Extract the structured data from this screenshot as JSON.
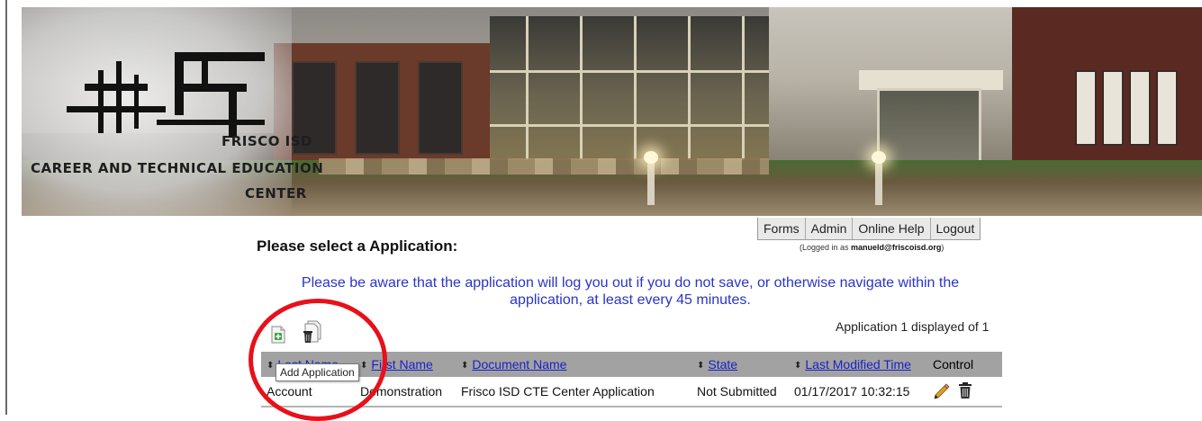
{
  "banner": {
    "logo_line1": "FRISCO ISD",
    "logo_line2": "CAREER AND TECHNICAL EDUCATION",
    "logo_line3": "CENTER"
  },
  "nav": {
    "items": [
      {
        "label": "Forms"
      },
      {
        "label": "Admin"
      },
      {
        "label": "Online Help"
      },
      {
        "label": "Logout"
      }
    ]
  },
  "page": {
    "heading": "Please select a Application:",
    "logged_in_prefix": "(Logged in as ",
    "logged_in_user": "manueld@friscoisd.org",
    "logged_in_suffix": ")",
    "notice_line1": "Please be aware that the application will log you out if you do not save, or otherwise navigate within the",
    "notice_line2": "application, at least every 45 minutes.",
    "count_text": "Application 1 displayed of 1"
  },
  "toolbar": {
    "add_icon": "add-document-icon",
    "delete_icon": "delete-multiple-icon",
    "tooltip": "Add Application"
  },
  "table": {
    "columns": [
      {
        "label": "Last Name",
        "sortable": true
      },
      {
        "label": "First Name",
        "sortable": true
      },
      {
        "label": "Document Name",
        "sortable": true
      },
      {
        "label": "State",
        "sortable": true
      },
      {
        "label": "Last Modified Time",
        "sortable": true
      },
      {
        "label": "Control",
        "sortable": false
      }
    ],
    "rows": [
      {
        "last_name": "Account",
        "first_name": "Demonstration",
        "document_name": "Frisco ISD CTE Center Application",
        "state": "Not Submitted",
        "last_modified": "01/17/2017 10:32:15",
        "edit_icon": "pencil-icon",
        "delete_icon": "trash-icon"
      }
    ]
  },
  "colors": {
    "notice_text": "#2a34c8",
    "link": "#1a22c8",
    "table_header": "#a2a2a2",
    "annotation": "#e8101a"
  }
}
